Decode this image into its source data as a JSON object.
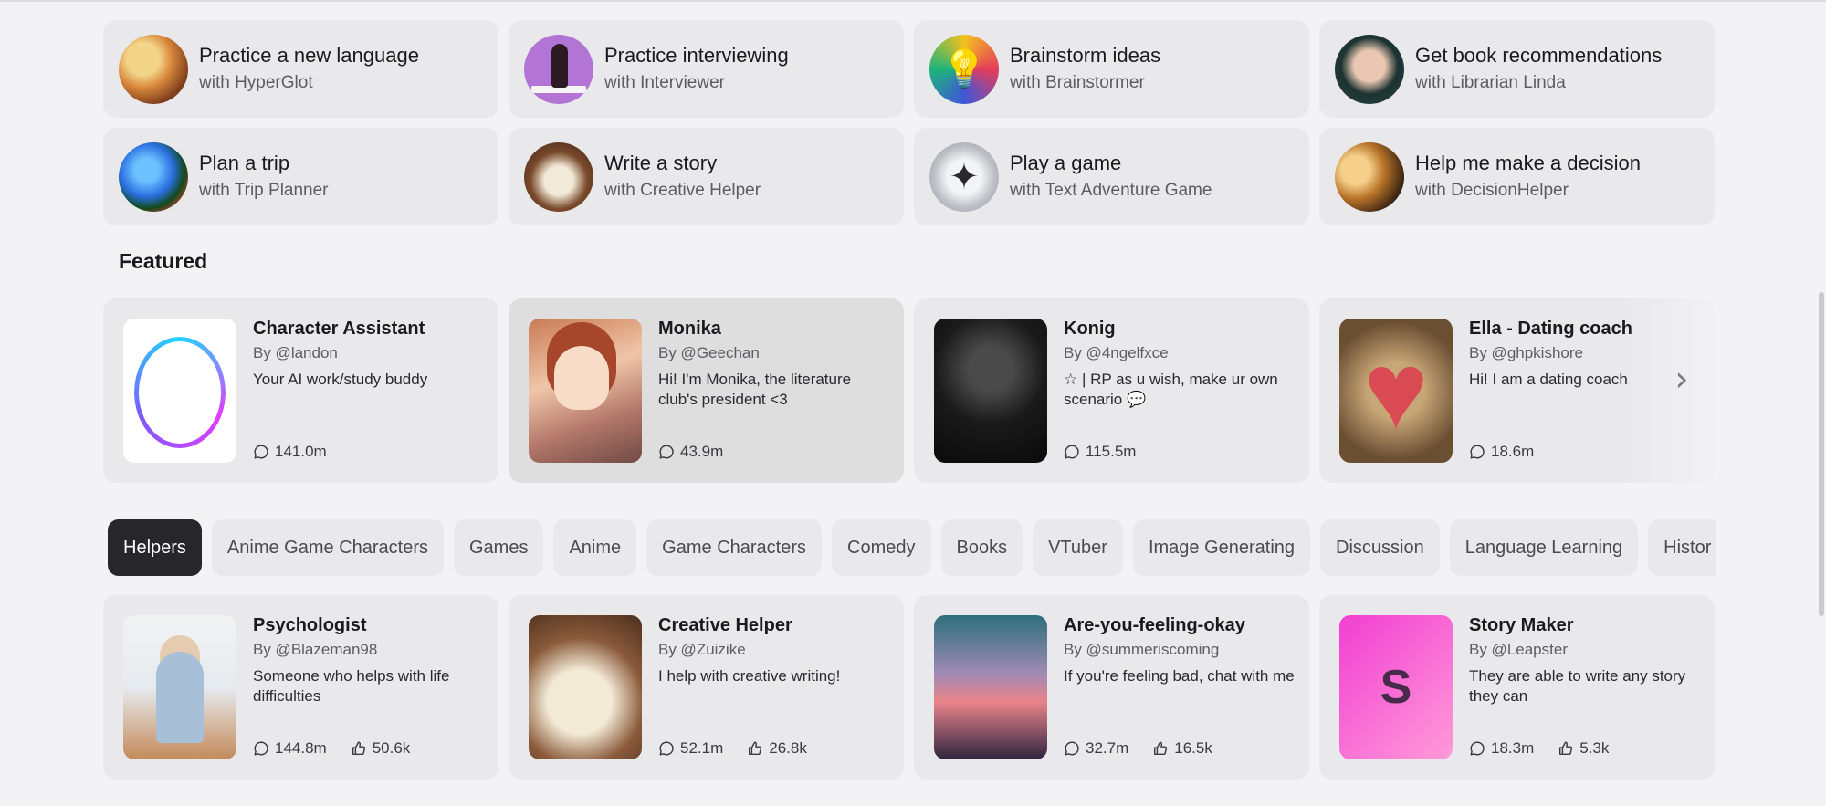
{
  "suggestions": [
    {
      "title": "Practice a new language",
      "subtitle": "with HyperGlot",
      "icon": "globe-icon"
    },
    {
      "title": "Practice interviewing",
      "subtitle": "with Interviewer",
      "icon": "interviewer-avatar"
    },
    {
      "title": "Brainstorm ideas",
      "subtitle": "with Brainstormer",
      "icon": "lightbulb-icon"
    },
    {
      "title": "Get book recommendations",
      "subtitle": "with Librarian Linda",
      "icon": "librarian-avatar"
    },
    {
      "title": "Plan a trip",
      "subtitle": "with Trip Planner",
      "icon": "globe-icon"
    },
    {
      "title": "Write a story",
      "subtitle": "with Creative Helper",
      "icon": "book-icon"
    },
    {
      "title": "Play a game",
      "subtitle": "with Text Adventure Game",
      "icon": "game-icon"
    },
    {
      "title": "Help me make a decision",
      "subtitle": "with DecisionHelper",
      "icon": "decision-avatar"
    }
  ],
  "featured": {
    "title": "Featured",
    "cards": [
      {
        "name": "Character Assistant",
        "by": "By @landon",
        "desc": "Your AI work/study buddy",
        "chats": "141.0m"
      },
      {
        "name": "Monika",
        "by": "By @Geechan",
        "desc": "Hi! I'm Monika, the literature club's president <3",
        "chats": "43.9m"
      },
      {
        "name": "Konig",
        "by": "By @4ngelfxce",
        "desc": "☆ | RP as u wish, make ur own scenario 💬",
        "chats": "115.5m"
      },
      {
        "name": "Ella - Dating coach",
        "by": "By @ghpkishore",
        "desc": "Hi! I am a dating coach",
        "chats": "18.6m"
      }
    ],
    "next_icon": "chevron-right-icon"
  },
  "categories": {
    "tabs": [
      "Helpers",
      "Anime Game Characters",
      "Games",
      "Anime",
      "Game Characters",
      "Comedy",
      "Books",
      "VTuber",
      "Image Generating",
      "Discussion",
      "Language Learning",
      "Histor"
    ],
    "active": "Helpers"
  },
  "helpers": [
    {
      "name": "Psychologist",
      "by": "By @Blazeman98",
      "desc": "Someone who helps with life difficulties",
      "chats": "144.8m",
      "likes": "50.6k"
    },
    {
      "name": "Creative Helper",
      "by": "By @Zuizike",
      "desc": "I help with creative writing!",
      "chats": "52.1m",
      "likes": "26.8k"
    },
    {
      "name": "Are-you-feeling-okay",
      "by": "By @summeriscoming",
      "desc": "If you're feeling bad, chat with me",
      "chats": "32.7m",
      "likes": "16.5k"
    },
    {
      "name": "Story Maker",
      "by": "By @Leapster",
      "desc": "They are able to write any story they can",
      "chats": "18.3m",
      "likes": "5.3k",
      "initial": "S"
    }
  ]
}
